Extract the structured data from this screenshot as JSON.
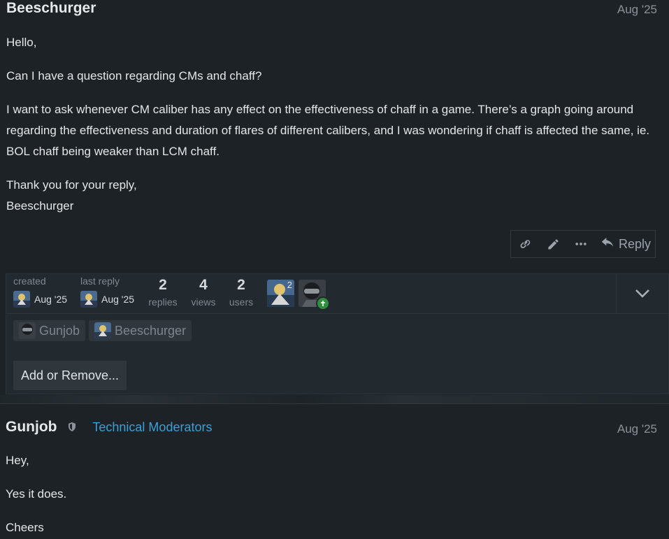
{
  "post1": {
    "author": "Beeschurger",
    "date": "Aug '25",
    "paragraphs": [
      "Hello,",
      "Can I have a question regarding CMs and chaff?",
      "I want to ask whenever CM caliber has any effect on the effectiveness of chaff in a game. There’s a graph going around regarding the effectiveness and duration of flares of different calibers, and I was wondering if chaff is affected the same, ie. BOL chaff being weaker than LCM chaff."
    ],
    "sign_off": [
      "Thank you for your reply,",
      "Beeschurger"
    ],
    "actions": {
      "link_icon": "link-icon",
      "edit_icon": "pencil-icon",
      "more_icon": "ellipsis-icon",
      "reply_icon": "reply-arrow-icon",
      "reply_label": "Reply"
    }
  },
  "topic_map": {
    "created_label": "created",
    "created_date": "Aug '25",
    "last_reply_label": "last reply",
    "last_reply_date": "Aug '25",
    "stats": [
      {
        "value": "2",
        "label": "replies"
      },
      {
        "value": "4",
        "label": "views"
      },
      {
        "value": "2",
        "label": "users"
      }
    ],
    "participant_badge": "2",
    "users": [
      "Gunjob",
      "Beeschurger"
    ],
    "add_remove_label": "Add or Remove..."
  },
  "post2": {
    "author": "Gunjob",
    "group": "Technical Moderators",
    "date": "Aug '25",
    "paragraphs": [
      "Hey,",
      "Yes it does.",
      "Cheers"
    ]
  },
  "colors": {
    "background": "#1c2226",
    "link_blue": "#3aa0d8",
    "muted_text": "#8c9298"
  }
}
